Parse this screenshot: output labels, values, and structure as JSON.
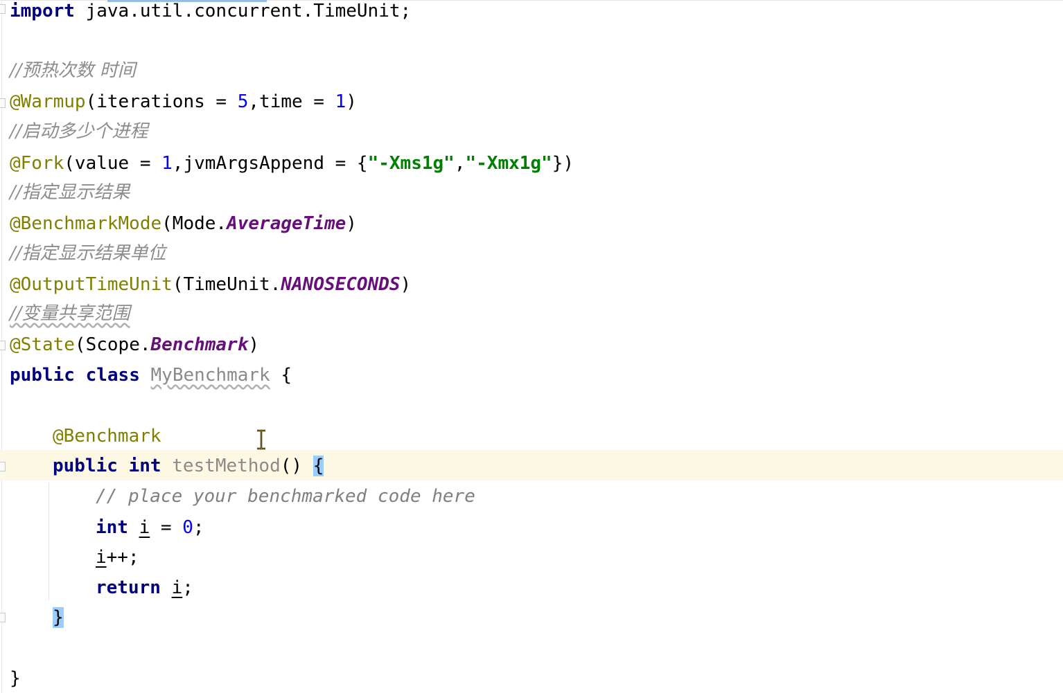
{
  "code": {
    "import": {
      "keyword": "import",
      "path": " java.util.concurrent.TimeUnit;"
    },
    "comment_warmup": "//预热次数 时间",
    "warmup": {
      "annotation": "@Warmup",
      "p1": "(iterations = ",
      "iterations": "5",
      "p2": ",time = ",
      "time": "1",
      "p3": ")"
    },
    "comment_fork": "//启动多少个进程",
    "fork": {
      "annotation": "@Fork",
      "p1": "(value = ",
      "value": "1",
      "p2": ",jvmArgsAppend = {",
      "arg1": "\"-Xms1g\"",
      "sep": ",",
      "arg2": "\"-Xmx1g\"",
      "p3": "})"
    },
    "comment_mode": "//指定显示结果",
    "mode": {
      "annotation": "@BenchmarkMode",
      "p1": "(Mode.",
      "constant": "AverageTime",
      "p2": ")"
    },
    "comment_unit": "//指定显示结果单位",
    "unit": {
      "annotation": "@OutputTimeUnit",
      "p1": "(TimeUnit.",
      "constant": "NANOSECONDS",
      "p2": ")"
    },
    "comment_state": "//变量共享范围",
    "state": {
      "annotation": "@State",
      "p1": "(Scope.",
      "constant": "Benchmark",
      "p2": ")"
    },
    "class_decl": {
      "kw1": "public",
      "kw2": "class",
      "name": "MyBenchmark",
      "brace": "{"
    },
    "method_annotation": "@Benchmark",
    "method_decl": {
      "kw1": "public",
      "kw2": "int",
      "name": "testMethod",
      "parens": "()",
      "brace": "{"
    },
    "body_comment": "// place your benchmarked code here",
    "decl": {
      "kw": "int",
      "var": "i",
      "op": " = ",
      "val": "0",
      "end": ";"
    },
    "incr": {
      "var": "i",
      "rest": "++;"
    },
    "ret": {
      "kw": "return",
      "var": "i",
      "end": ";"
    },
    "method_close": "}",
    "class_close": "}"
  },
  "icons": {
    "cursor": "text-cursor-icon",
    "fold": "fold-marker-icon"
  },
  "colors": {
    "keyword": "#000080",
    "annotation": "#808000",
    "number": "#0000ff",
    "string": "#008000",
    "comment": "#808080",
    "static_field": "#660e7a",
    "current_line": "#fdf8e3",
    "brace_highlight": "#99ccff"
  }
}
